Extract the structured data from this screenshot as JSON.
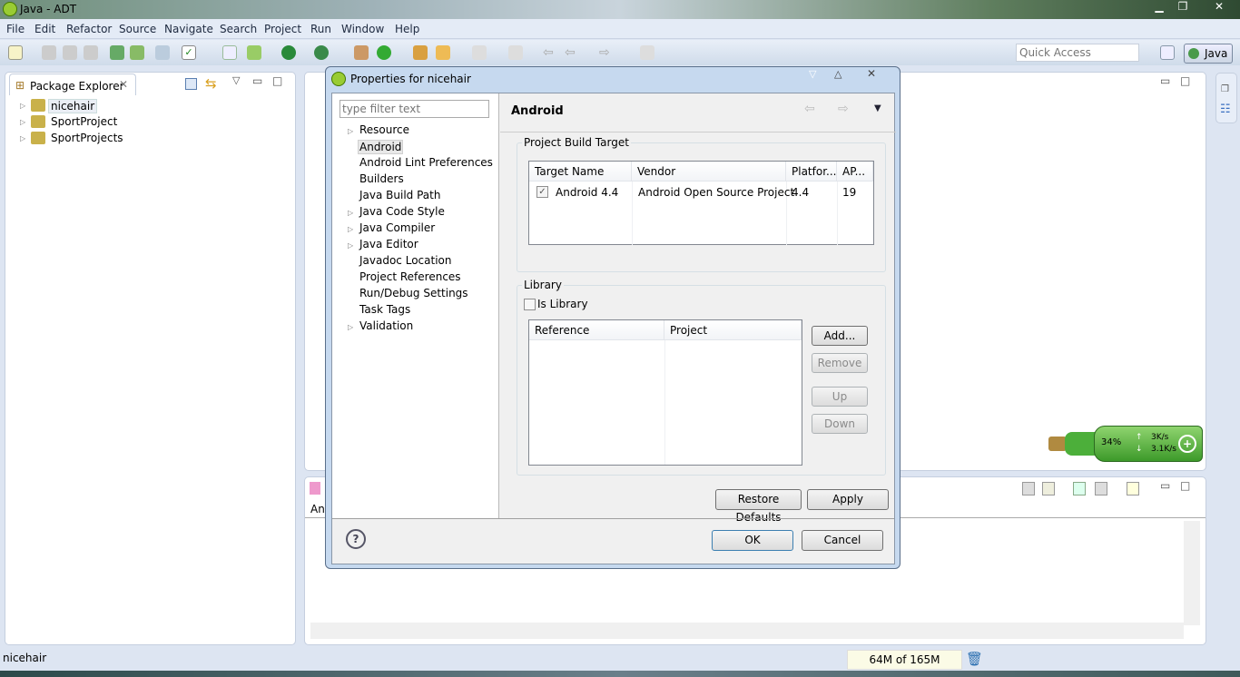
{
  "window": {
    "title": "Java - ADT"
  },
  "menu": [
    "File",
    "Edit",
    "Refactor",
    "Source",
    "Navigate",
    "Search",
    "Project",
    "Run",
    "Window",
    "Help"
  ],
  "quick_access": {
    "placeholder": "Quick Access"
  },
  "perspective": {
    "label": "Java"
  },
  "package_explorer": {
    "title": "Package Explorer",
    "projects": [
      "nicehair",
      "SportProject",
      "SportProjects"
    ]
  },
  "bottom_panel": {
    "tab_fragment": "An"
  },
  "status": {
    "selection": "nicehair",
    "memory": "64M of 165M"
  },
  "network_widget": {
    "percent": "34%",
    "up": "3K/s",
    "down": "3.1K/s"
  },
  "dialog": {
    "title": "Properties for nicehair",
    "filter_placeholder": "type filter text",
    "tree": [
      {
        "label": "Resource",
        "expandable": true
      },
      {
        "label": "Android",
        "selected": true
      },
      {
        "label": "Android Lint Preferences"
      },
      {
        "label": "Builders"
      },
      {
        "label": "Java Build Path"
      },
      {
        "label": "Java Code Style",
        "expandable": true
      },
      {
        "label": "Java Compiler",
        "expandable": true
      },
      {
        "label": "Java Editor",
        "expandable": true
      },
      {
        "label": "Javadoc Location"
      },
      {
        "label": "Project References"
      },
      {
        "label": "Run/Debug Settings"
      },
      {
        "label": "Task Tags"
      },
      {
        "label": "Validation",
        "expandable": true
      }
    ],
    "page_title": "Android",
    "build_target": {
      "group_label": "Project Build Target",
      "columns": [
        "Target Name",
        "Vendor",
        "Platfor...",
        "AP..."
      ],
      "rows": [
        {
          "checked": true,
          "name": "Android 4.4",
          "vendor": "Android Open Source Project",
          "platform": "4.4",
          "api": "19"
        }
      ]
    },
    "library": {
      "group_label": "Library",
      "is_library_label": "Is Library",
      "is_library": false,
      "columns": [
        "Reference",
        "Project"
      ],
      "buttons": {
        "add": "Add...",
        "remove": "Remove",
        "up": "Up",
        "down": "Down"
      }
    },
    "restore_defaults": "Restore Defaults",
    "apply": "Apply",
    "ok": "OK",
    "cancel": "Cancel"
  },
  "colors": {
    "accent": "#3d6ea8",
    "widget_green": "#4caf3a"
  }
}
